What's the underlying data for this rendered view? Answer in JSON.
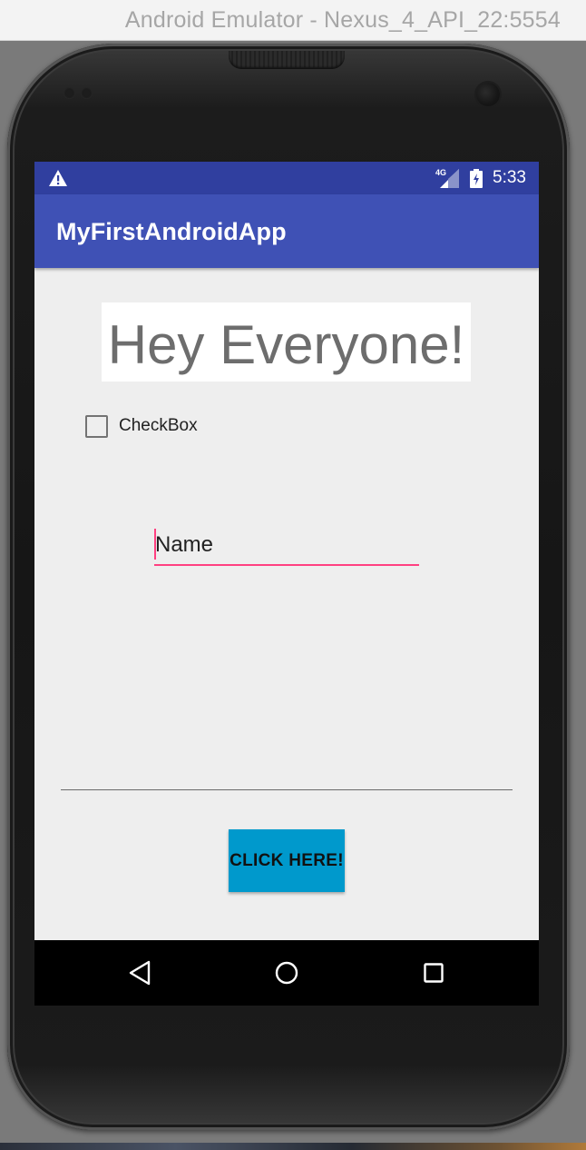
{
  "window": {
    "title": "Android Emulator - Nexus_4_API_22:5554"
  },
  "status_bar": {
    "network_label": "4G",
    "time": "5:33",
    "icons": [
      "warning-icon",
      "signal-icon",
      "battery-icon"
    ],
    "color": "#303f9f"
  },
  "app_bar": {
    "title": "MyFirstAndroidApp",
    "color": "#3f51b5"
  },
  "content": {
    "headline": "Hey Everyone!",
    "checkbox": {
      "label": "CheckBox",
      "checked": false
    },
    "name_field": {
      "value": "Name",
      "accent": "#ff4081"
    },
    "button": {
      "label": "CLICK HERE!",
      "color": "#0099cc"
    }
  },
  "nav_bar": {
    "buttons": [
      "back-icon",
      "home-icon",
      "recents-icon"
    ]
  }
}
